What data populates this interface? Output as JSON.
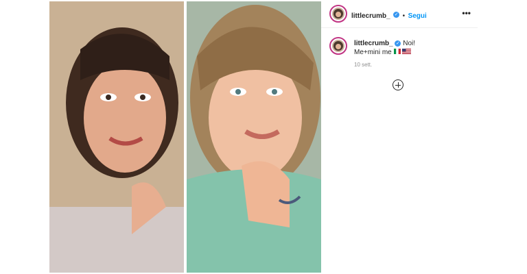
{
  "post": {
    "author": "littlecrumb_",
    "header_separator": "•",
    "follow_label": "Segui",
    "more_label": "•••",
    "caption": {
      "author": "littlecrumb_",
      "line1": "Noi!",
      "line2": "Me+mini me"
    },
    "timestamp": "10 sett.",
    "flags": [
      "flag-italy-icon",
      "flag-usa-icon"
    ],
    "accent_color": "#0095f6",
    "verified_color": "#3897f0"
  }
}
